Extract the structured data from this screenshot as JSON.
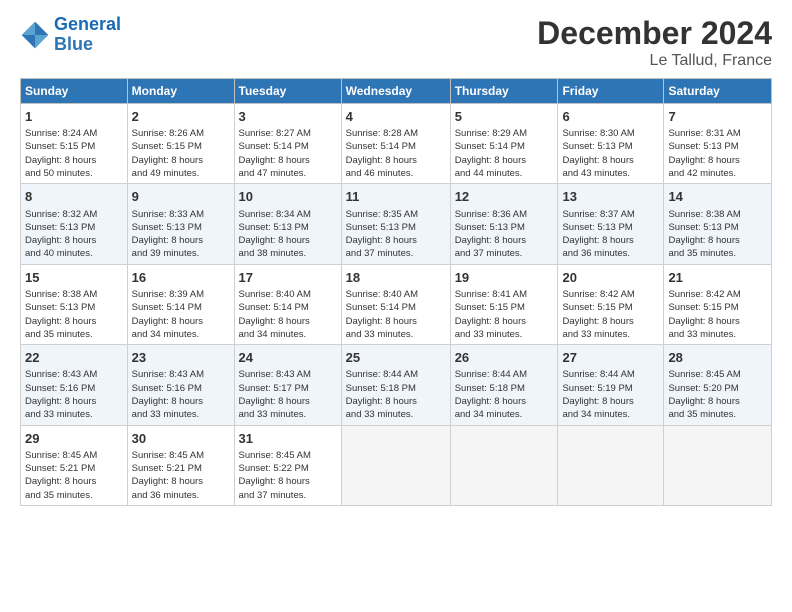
{
  "header": {
    "logo_line1": "General",
    "logo_line2": "Blue",
    "title": "December 2024",
    "subtitle": "Le Tallud, France"
  },
  "weekdays": [
    "Sunday",
    "Monday",
    "Tuesday",
    "Wednesday",
    "Thursday",
    "Friday",
    "Saturday"
  ],
  "weeks": [
    [
      {
        "day": "1",
        "info": "Sunrise: 8:24 AM\nSunset: 5:15 PM\nDaylight: 8 hours\nand 50 minutes."
      },
      {
        "day": "2",
        "info": "Sunrise: 8:26 AM\nSunset: 5:15 PM\nDaylight: 8 hours\nand 49 minutes."
      },
      {
        "day": "3",
        "info": "Sunrise: 8:27 AM\nSunset: 5:14 PM\nDaylight: 8 hours\nand 47 minutes."
      },
      {
        "day": "4",
        "info": "Sunrise: 8:28 AM\nSunset: 5:14 PM\nDaylight: 8 hours\nand 46 minutes."
      },
      {
        "day": "5",
        "info": "Sunrise: 8:29 AM\nSunset: 5:14 PM\nDaylight: 8 hours\nand 44 minutes."
      },
      {
        "day": "6",
        "info": "Sunrise: 8:30 AM\nSunset: 5:13 PM\nDaylight: 8 hours\nand 43 minutes."
      },
      {
        "day": "7",
        "info": "Sunrise: 8:31 AM\nSunset: 5:13 PM\nDaylight: 8 hours\nand 42 minutes."
      }
    ],
    [
      {
        "day": "8",
        "info": "Sunrise: 8:32 AM\nSunset: 5:13 PM\nDaylight: 8 hours\nand 40 minutes."
      },
      {
        "day": "9",
        "info": "Sunrise: 8:33 AM\nSunset: 5:13 PM\nDaylight: 8 hours\nand 39 minutes."
      },
      {
        "day": "10",
        "info": "Sunrise: 8:34 AM\nSunset: 5:13 PM\nDaylight: 8 hours\nand 38 minutes."
      },
      {
        "day": "11",
        "info": "Sunrise: 8:35 AM\nSunset: 5:13 PM\nDaylight: 8 hours\nand 37 minutes."
      },
      {
        "day": "12",
        "info": "Sunrise: 8:36 AM\nSunset: 5:13 PM\nDaylight: 8 hours\nand 37 minutes."
      },
      {
        "day": "13",
        "info": "Sunrise: 8:37 AM\nSunset: 5:13 PM\nDaylight: 8 hours\nand 36 minutes."
      },
      {
        "day": "14",
        "info": "Sunrise: 8:38 AM\nSunset: 5:13 PM\nDaylight: 8 hours\nand 35 minutes."
      }
    ],
    [
      {
        "day": "15",
        "info": "Sunrise: 8:38 AM\nSunset: 5:13 PM\nDaylight: 8 hours\nand 35 minutes."
      },
      {
        "day": "16",
        "info": "Sunrise: 8:39 AM\nSunset: 5:14 PM\nDaylight: 8 hours\nand 34 minutes."
      },
      {
        "day": "17",
        "info": "Sunrise: 8:40 AM\nSunset: 5:14 PM\nDaylight: 8 hours\nand 34 minutes."
      },
      {
        "day": "18",
        "info": "Sunrise: 8:40 AM\nSunset: 5:14 PM\nDaylight: 8 hours\nand 33 minutes."
      },
      {
        "day": "19",
        "info": "Sunrise: 8:41 AM\nSunset: 5:15 PM\nDaylight: 8 hours\nand 33 minutes."
      },
      {
        "day": "20",
        "info": "Sunrise: 8:42 AM\nSunset: 5:15 PM\nDaylight: 8 hours\nand 33 minutes."
      },
      {
        "day": "21",
        "info": "Sunrise: 8:42 AM\nSunset: 5:15 PM\nDaylight: 8 hours\nand 33 minutes."
      }
    ],
    [
      {
        "day": "22",
        "info": "Sunrise: 8:43 AM\nSunset: 5:16 PM\nDaylight: 8 hours\nand 33 minutes."
      },
      {
        "day": "23",
        "info": "Sunrise: 8:43 AM\nSunset: 5:16 PM\nDaylight: 8 hours\nand 33 minutes."
      },
      {
        "day": "24",
        "info": "Sunrise: 8:43 AM\nSunset: 5:17 PM\nDaylight: 8 hours\nand 33 minutes."
      },
      {
        "day": "25",
        "info": "Sunrise: 8:44 AM\nSunset: 5:18 PM\nDaylight: 8 hours\nand 33 minutes."
      },
      {
        "day": "26",
        "info": "Sunrise: 8:44 AM\nSunset: 5:18 PM\nDaylight: 8 hours\nand 34 minutes."
      },
      {
        "day": "27",
        "info": "Sunrise: 8:44 AM\nSunset: 5:19 PM\nDaylight: 8 hours\nand 34 minutes."
      },
      {
        "day": "28",
        "info": "Sunrise: 8:45 AM\nSunset: 5:20 PM\nDaylight: 8 hours\nand 35 minutes."
      }
    ],
    [
      {
        "day": "29",
        "info": "Sunrise: 8:45 AM\nSunset: 5:21 PM\nDaylight: 8 hours\nand 35 minutes."
      },
      {
        "day": "30",
        "info": "Sunrise: 8:45 AM\nSunset: 5:21 PM\nDaylight: 8 hours\nand 36 minutes."
      },
      {
        "day": "31",
        "info": "Sunrise: 8:45 AM\nSunset: 5:22 PM\nDaylight: 8 hours\nand 37 minutes."
      },
      {
        "day": "",
        "info": ""
      },
      {
        "day": "",
        "info": ""
      },
      {
        "day": "",
        "info": ""
      },
      {
        "day": "",
        "info": ""
      }
    ]
  ]
}
